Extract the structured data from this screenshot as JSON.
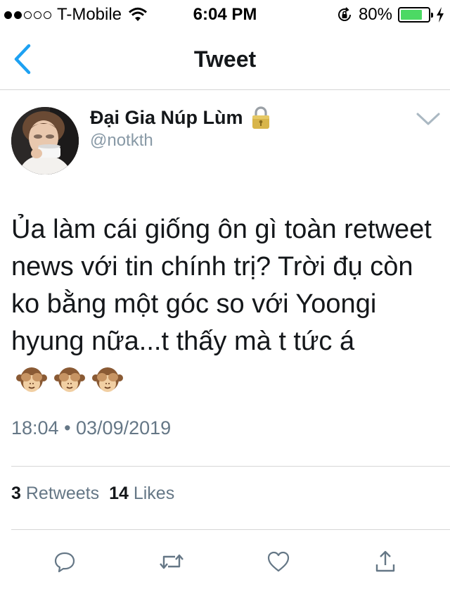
{
  "status_bar": {
    "carrier": "T-Mobile",
    "time": "6:04 PM",
    "battery_percent": "80%",
    "battery_level": 0.8,
    "signal_bars": 2,
    "battery_color": "#4cd964"
  },
  "nav": {
    "title": "Tweet",
    "back_icon": "chevron-left-icon",
    "accent_color": "#1da1f2"
  },
  "tweet": {
    "user_name": "Đại Gia Núp Lùm",
    "handle": "@notkth",
    "protected_icon": "lock-icon",
    "text": "Ủa làm cái giống ôn gì toàn retweet news với tin chính trị? Trời đụ còn ko bằng một góc so với Yoongi hyung nữa...t thấy mà t tức á",
    "emojis": [
      "see-no-evil-monkey",
      "see-no-evil-monkey",
      "see-no-evil-monkey"
    ],
    "timestamp": "18:04 • 03/09/2019",
    "retweets_count": "3",
    "retweets_label": "Retweets",
    "likes_count": "14",
    "likes_label": "Likes"
  },
  "actions": [
    {
      "icon": "reply-icon"
    },
    {
      "icon": "retweet-icon"
    },
    {
      "icon": "like-icon"
    },
    {
      "icon": "share-icon"
    }
  ]
}
